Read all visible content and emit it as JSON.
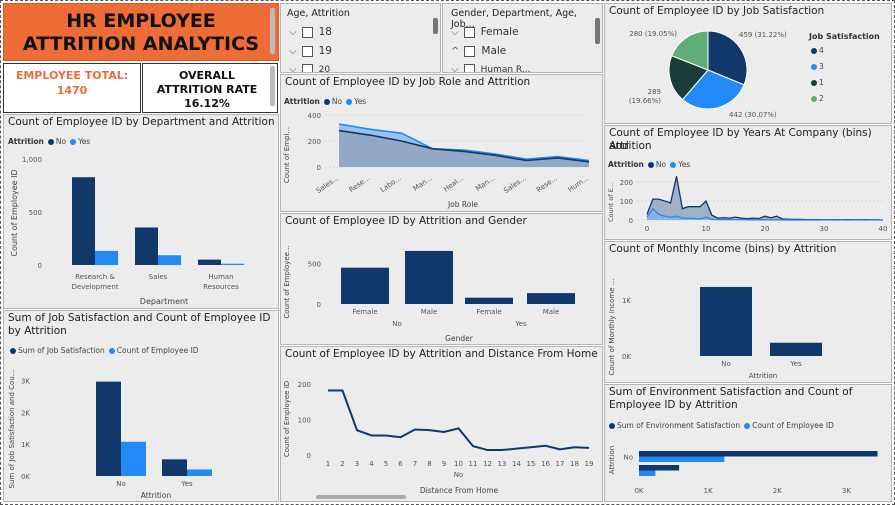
{
  "title": {
    "line1": "HR EMPLOYEE",
    "line2": "ATTRITION ANALYTICS"
  },
  "kpi": {
    "total_label": "EMPLOYEE TOTAL:",
    "total_value": "1470",
    "rate_label_1": "OVERALL",
    "rate_label_2": "ATTRITION RATE",
    "rate_value": "16.12%"
  },
  "slicers": {
    "age": {
      "title": "Age, Attrition",
      "items": [
        "18",
        "19",
        "20"
      ]
    },
    "gender": {
      "title": "Gender, Department, Age, Job...",
      "items": [
        "Female",
        "Male",
        "Human R..."
      ]
    }
  },
  "colors": {
    "no": "#11386b",
    "yes": "#2289f5",
    "sat4": "#11386b",
    "sat3": "#2289f5",
    "sat1": "#1a3d3a",
    "sat2": "#5fae78"
  },
  "legend": {
    "attrition": "Attrition",
    "no": "No",
    "yes": "Yes",
    "job_sat": "Job Satisfaction",
    "sum_js": "Sum of Job Satisfaction",
    "count_emp": "Count of Employee ID",
    "sum_env": "Sum of Environment Satisfaction"
  },
  "charts": {
    "dept": {
      "title": "Count of Employee ID by Department and Attrition",
      "ylabel": "Count of Employee ID",
      "xlabel": "Department",
      "yticks": [
        "1,000",
        "500",
        "0"
      ]
    },
    "sum_js": {
      "title_1": "Sum of Job Satisfaction and Count of Employee ID",
      "title_2": "by Attrition",
      "ylabel": "Sum of Job Satisfaction and Cou...",
      "xlabel": "Attrition",
      "yticks": [
        "3K",
        "2K",
        "1K",
        "0K"
      ]
    },
    "jobrole": {
      "title": "Count of Employee ID by Job Role and Attrition",
      "ylabel": "Count of Empl...",
      "xlabel": "Job Role",
      "yticks": [
        "400",
        "200",
        "0"
      ]
    },
    "gender": {
      "title": "Count of Employee ID by Attrition and Gender",
      "ylabel": "Count of Employee...",
      "xlabel": "Gender",
      "yticks": [
        "500",
        "0"
      ]
    },
    "distance": {
      "title": "Count of Employee ID by Attrition and Distance From Home",
      "ylabel": "Count of Employee ID",
      "xlabel": "Distance From Home",
      "yticks": [
        "200",
        "100",
        "0"
      ],
      "group_label": "No"
    },
    "jobsat": {
      "title": "Count of Employee ID by Job Satisfaction"
    },
    "years": {
      "title_1": "Count of Employee ID by Years At Company (bins) and",
      "title_2": "Attrition",
      "ylabel": "Count of E...",
      "yticks": [
        "200",
        "100",
        "0"
      ],
      "xticks": [
        "0",
        "10",
        "20",
        "30",
        "40"
      ]
    },
    "income": {
      "title": "Count of Monthly Income (bins) by Attrition",
      "ylabel": "Count of Monthly Income ...",
      "xlabel": "Attrition",
      "yticks": [
        "1K",
        "0K"
      ]
    },
    "env": {
      "title_1": "Sum of Environment Satisfaction and Count of",
      "title_2": "Employee ID by Attrition",
      "ylabel": "Attrition",
      "xticks": [
        "0K",
        "1K",
        "2K",
        "3K"
      ]
    }
  },
  "chart_data": [
    {
      "type": "bar",
      "title": "Count of Employee ID by Department and Attrition",
      "xlabel": "Department",
      "ylabel": "Count of Employee ID",
      "categories": [
        "Research & Development",
        "Sales",
        "Human Resources"
      ],
      "series": [
        {
          "name": "No",
          "values": [
            828,
            354,
            51
          ]
        },
        {
          "name": "Yes",
          "values": [
            133,
            92,
            12
          ]
        }
      ],
      "ylim": [
        0,
        1000
      ]
    },
    {
      "type": "bar",
      "title": "Sum of Job Satisfaction and Count of Employee ID by Attrition",
      "xlabel": "Attrition",
      "categories": [
        "No",
        "Yes"
      ],
      "series": [
        {
          "name": "Sum of Job Satisfaction",
          "values": [
            3400,
            600
          ]
        },
        {
          "name": "Count of Employee ID",
          "values": [
            1233,
            237
          ]
        }
      ],
      "ylim": [
        0,
        4000
      ]
    },
    {
      "type": "area",
      "title": "Count of Employee ID by Job Role and Attrition",
      "xlabel": "Job Role",
      "ylabel": "Count of Empl...",
      "categories": [
        "Sales...",
        "Rese...",
        "Labo...",
        "Man...",
        "Heal...",
        "Man...",
        "Sales...",
        "Rese...",
        "Hum..."
      ],
      "series": [
        {
          "name": "No",
          "values": [
            280,
            245,
            200,
            140,
            120,
            90,
            50,
            70,
            40
          ]
        },
        {
          "name": "Yes",
          "values": [
            330,
            290,
            260,
            140,
            130,
            100,
            60,
            80,
            50
          ]
        }
      ],
      "ylim": [
        0,
        400
      ]
    },
    {
      "type": "bar",
      "title": "Count of Employee ID by Attrition and Gender",
      "xlabel": "Gender",
      "categories": [
        "Female",
        "Male",
        "Female",
        "Male"
      ],
      "groups": [
        "No",
        "Yes"
      ],
      "values": [
        501,
        732,
        87,
        150
      ],
      "ylim": [
        0,
        800
      ]
    },
    {
      "type": "line",
      "title": "Count of Employee ID by Attrition and Distance From Home",
      "xlabel": "Distance From Home",
      "ylabel": "Count of Employee ID",
      "x": [
        1,
        2,
        3,
        4,
        5,
        6,
        7,
        8,
        9,
        10,
        11,
        12,
        13,
        14,
        15,
        16,
        17,
        18,
        19
      ],
      "values": [
        182,
        182,
        70,
        55,
        55,
        50,
        72,
        70,
        65,
        75,
        25,
        14,
        14,
        18,
        22,
        26,
        16,
        22,
        20
      ],
      "ylim": [
        0,
        220
      ]
    },
    {
      "type": "pie",
      "title": "Count of Employee ID by Job Satisfaction",
      "legend_title": "Job Satisfaction",
      "labels": [
        "4",
        "3",
        "1",
        "2"
      ],
      "values": [
        459,
        442,
        289,
        280
      ],
      "value_labels": [
        "459 (31.22%)",
        "442 (30.07%)",
        "289 (19.66%)",
        "280 (19.05%)"
      ]
    },
    {
      "type": "area",
      "title": "Count of Employee ID by Years At Company (bins) and Attrition",
      "ylabel": "Count of E...",
      "x": [
        0,
        1,
        2,
        3,
        4,
        5,
        6,
        7,
        8,
        9,
        10,
        11,
        12,
        13,
        14,
        15,
        16,
        17,
        18,
        19,
        20,
        21,
        22,
        23,
        24,
        25,
        26,
        27,
        28,
        29,
        30,
        31,
        32,
        33,
        34,
        35,
        36,
        37,
        38,
        39,
        40
      ],
      "series": [
        {
          "name": "No",
          "values": [
            30,
            110,
            110,
            100,
            90,
            230,
            60,
            70,
            70,
            70,
            100,
            25,
            10,
            12,
            10,
            15,
            10,
            7,
            10,
            8,
            20,
            12,
            20,
            5,
            4,
            3,
            3,
            2,
            2,
            2,
            1,
            1,
            2,
            1,
            2,
            1,
            1,
            2,
            1,
            1,
            0
          ]
        },
        {
          "name": "Yes",
          "values": [
            15,
            60,
            30,
            20,
            15,
            20,
            10,
            10,
            8,
            6,
            15,
            3,
            2,
            2,
            2,
            2,
            2,
            1,
            1,
            1,
            1,
            1,
            1,
            0,
            0,
            0,
            0,
            0,
            0,
            0,
            0,
            0,
            0,
            0,
            0,
            0,
            0,
            0,
            0,
            0,
            0
          ]
        }
      ],
      "ylim": [
        0,
        200
      ]
    },
    {
      "type": "bar",
      "title": "Count of Monthly Income (bins) by Attrition",
      "xlabel": "Attrition",
      "categories": [
        "No",
        "Yes"
      ],
      "values": [
        1233,
        237
      ],
      "ylim": [
        0,
        1500
      ]
    },
    {
      "type": "bar",
      "title": "Sum of Environment Satisfaction and Count of Employee ID by Attrition",
      "ylabel": "Attrition",
      "orientation": "horizontal",
      "categories": [
        "No",
        "Yes"
      ],
      "series": [
        {
          "name": "Sum of Environment Satisfaction",
          "values": [
            3450,
            580
          ]
        },
        {
          "name": "Count of Employee ID",
          "values": [
            1233,
            237
          ]
        }
      ],
      "xlim": [
        0,
        3500
      ]
    }
  ]
}
